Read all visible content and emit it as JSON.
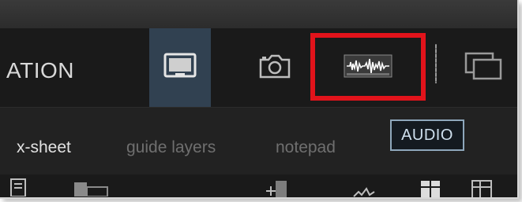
{
  "header": {
    "title": "ATION"
  },
  "toolbar": {
    "modes": [
      {
        "name": "display-mode",
        "icon": "monitor-icon",
        "active": true
      },
      {
        "name": "camera-mode",
        "icon": "camera-icon",
        "active": false
      },
      {
        "name": "audio-waveform-mode",
        "icon": "waveform-icon",
        "active": false,
        "highlighted": true
      },
      {
        "name": "multi-window-mode",
        "icon": "stacked-windows-icon",
        "active": false
      }
    ],
    "highlight_color": "#e2131b",
    "active_color": "#314151"
  },
  "tabs": {
    "items": [
      {
        "label": "x-sheet",
        "current": true
      },
      {
        "label": "guide layers",
        "current": false
      },
      {
        "label": "notepad",
        "current": false
      }
    ],
    "audio_label": "AUDIO"
  },
  "bottom_tools": {
    "icons": [
      "list-icon",
      "folder-icon",
      "insert-frame-icon",
      "wave-icon",
      "grid-icon",
      "table-icon"
    ]
  }
}
